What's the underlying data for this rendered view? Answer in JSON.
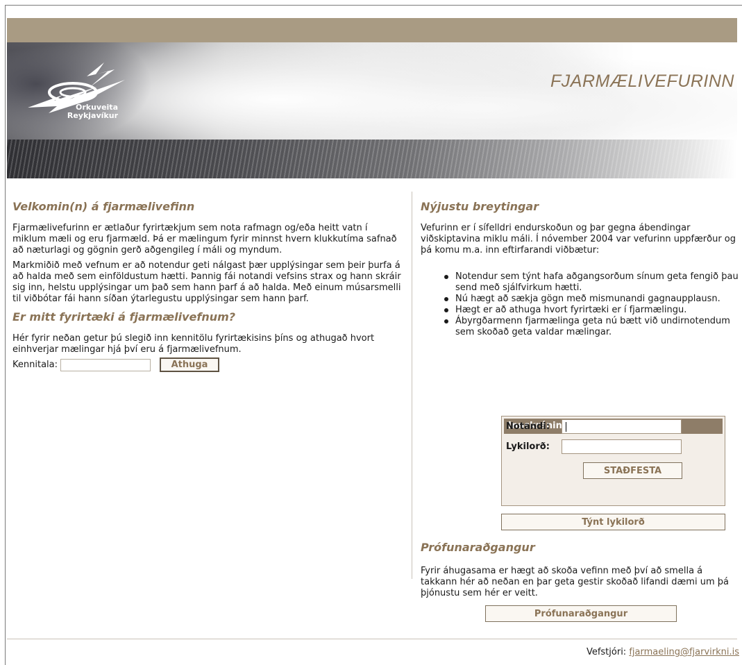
{
  "header": {
    "title": "FJARMÆLIVEFURINN",
    "logo": {
      "icon": "orkuveita-swirl-logo",
      "lines": [
        "Orkuveita",
        "Reykjavíkur"
      ]
    }
  },
  "welcome": {
    "heading": "Velkomin(n) á fjarmælivefinn",
    "p1": "Fjarmælivefurinn er ætlaður fyrirtækjum sem nota rafmagn og/eða heitt vatn í miklum mæli og eru fjarmæld.  Þá er mælingum fyrir minnst hvern klukkutíma safnað að næturlagi og gögnin gerð aðgengileg í máli og myndum.",
    "p2": "Markmiðið með vefnum er að notendur geti nálgast þær upplýsingar sem þeir þurfa á að halda með sem einföldustum hætti.  Þannig fái notandi vefsins strax og hann skráir sig inn, helstu upplýsingar um það sem hann þarf á að halda.  Með einum músarsmelli til viðbótar fái hann síðan ýtarlegustu upplýsingar sem hann þarf."
  },
  "check": {
    "heading": "Er mitt fyrirtæki á fjarmælivefnum?",
    "text": "Hér fyrir neðan getur þú slegið inn kennitölu fyrirtækisins þíns og athugað hvort einhverjar mælingar hjá því eru á fjarmælivefnum.",
    "label": "Kennitala:",
    "value": "",
    "button": "Athuga"
  },
  "news": {
    "heading": "Nýjustu breytingar",
    "intro": "Vefurinn er í sífelldri endurskoðun og þar gegna ábendingar viðskiptavina miklu máli. Í nóvember 2004 var vefurinn uppfærður og þá komu m.a. inn eftirfarandi viðbætur:",
    "items": [
      "Notendur sem týnt hafa aðgangsorðum sínum geta fengið þau send með sjálfvirkum hætti.",
      "Nú hægt að sækja gögn með mismunandi gagnaupplausn.",
      "Hægt er að athuga hvort fyrirtæki er í fjarmælingu.",
      "Ábyrgðarmenn fjarmælinga geta nú bætt við undirnotendum sem skoðað geta valdar mælingar."
    ]
  },
  "login": {
    "title": "Innskráning",
    "user_label": "Notandi:",
    "user_value": "",
    "password_label": "Lykilorð:",
    "password_value": "",
    "submit": "STAÐFESTA",
    "forgot": "Týnt lykilorð"
  },
  "trial": {
    "heading": "Prófunaraðgangur",
    "text": "Fyrir áhugasama er hægt að skoða vefinn með því að smella á takkann hér að neðan en þar geta gestir skoðað lifandi dæmi um þá þjónustu sem hér er veitt.",
    "button": "Prófunaraðgangur"
  },
  "footer": {
    "label": "Vefstjóri:",
    "email": "fjarmaeling@fjarvirkni.is"
  },
  "colors": {
    "brand_brown": "#8a7356",
    "top_bar": "#a99b83",
    "login_header": "#8e7d68"
  }
}
